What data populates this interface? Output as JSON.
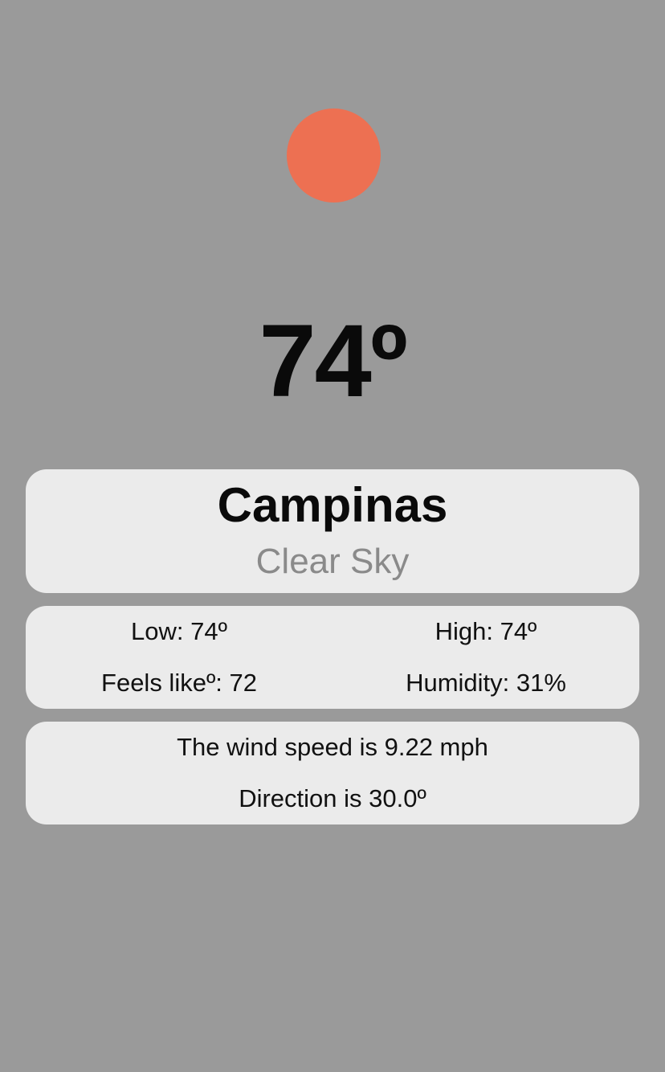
{
  "weather": {
    "icon": "sun-icon",
    "icon_color": "#ed7052",
    "temperature": "74º",
    "city": "Campinas",
    "description": "Clear Sky"
  },
  "stats": {
    "low": "Low: 74º",
    "high": "High: 74º",
    "feels_like": "Feels likeº: 72",
    "humidity": "Humidity: 31%"
  },
  "wind": {
    "speed": "The wind speed is 9.22 mph",
    "direction": "Direction is 30.0º"
  }
}
